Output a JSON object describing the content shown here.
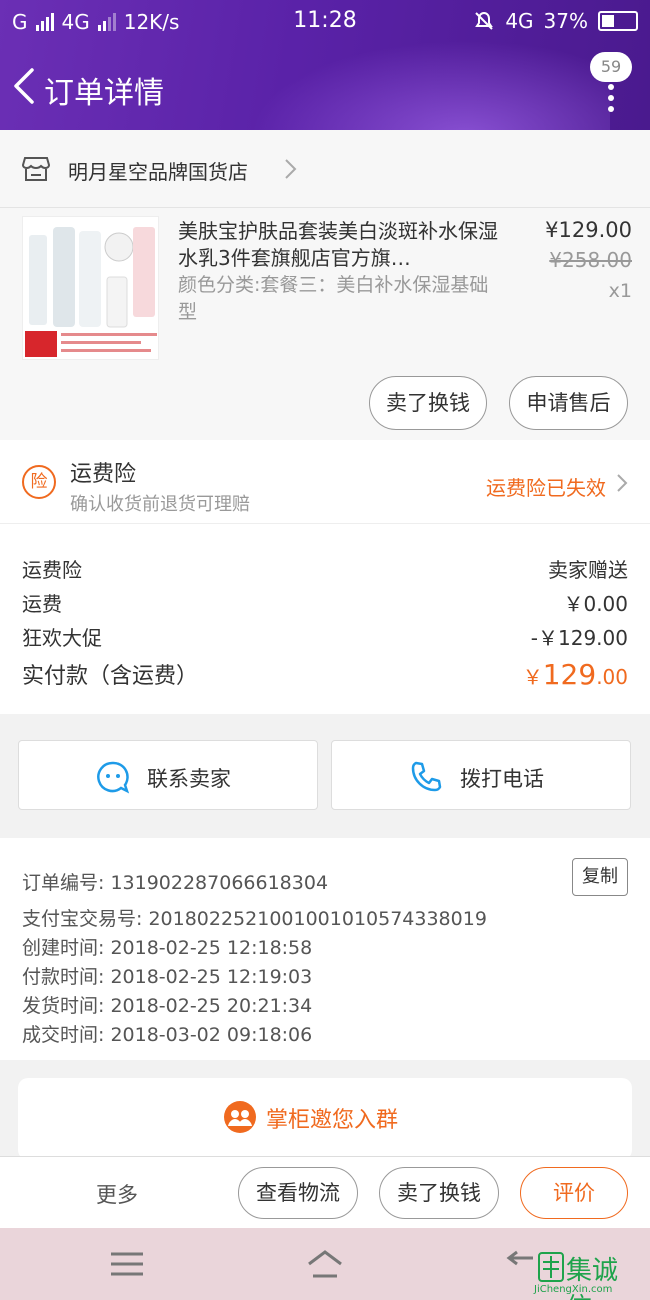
{
  "status_bar": {
    "carrier": "G",
    "network": "4G",
    "speed": "12K/s",
    "time": "11:28",
    "network2": "4G",
    "battery": "37%"
  },
  "header": {
    "title": "订单详情",
    "badge_count": "59"
  },
  "shop": {
    "name": "明月星空品牌国货店"
  },
  "product": {
    "name": "美肤宝护肤品套装美白淡斑补水保湿水乳3件套旗舰店官方旗…",
    "sku": "颜色分类:套餐三：美白补水保湿基础型",
    "price": "¥129.00",
    "original_price": "¥258.00",
    "quantity": "x1",
    "buttons": [
      "卖了换钱",
      "申请售后"
    ]
  },
  "insurance": {
    "badge": "险",
    "title": "运费险",
    "subtitle": "确认收货前退货可理赔",
    "status": "运费险已失效"
  },
  "fees": [
    {
      "label": "运费险",
      "value": "卖家赠送"
    },
    {
      "label": "运费",
      "value": "￥0.00"
    },
    {
      "label": "狂欢大促",
      "value": "-￥129.00"
    }
  ],
  "total": {
    "label": "实付款（含运费）",
    "currency": "￥",
    "integer": "129",
    "decimal": ".00"
  },
  "contact": {
    "seller": "联系卖家",
    "call": "拨打电话"
  },
  "order_info": {
    "copy": "复制",
    "rows": [
      "订单编号: 131902287066618304",
      "支付宝交易号: 2018022521001001010574338019",
      "创建时间: 2018-02-25 12:18:58",
      "付款时间: 2018-02-25 12:19:03",
      "发货时间: 2018-02-25 20:21:34",
      "成交时间: 2018-03-02 09:18:06"
    ]
  },
  "group": {
    "label": "掌柜邀您入群"
  },
  "bottom_actions": {
    "more": "更多",
    "logistics": "查看物流",
    "resell": "卖了换钱",
    "review": "评价"
  },
  "watermark": {
    "text": "集诚信",
    "sub": "JiChengXin.com"
  },
  "colors": {
    "header": "#5a22a8",
    "accent": "#f06a1f",
    "nav_bar": "#ead5da"
  }
}
